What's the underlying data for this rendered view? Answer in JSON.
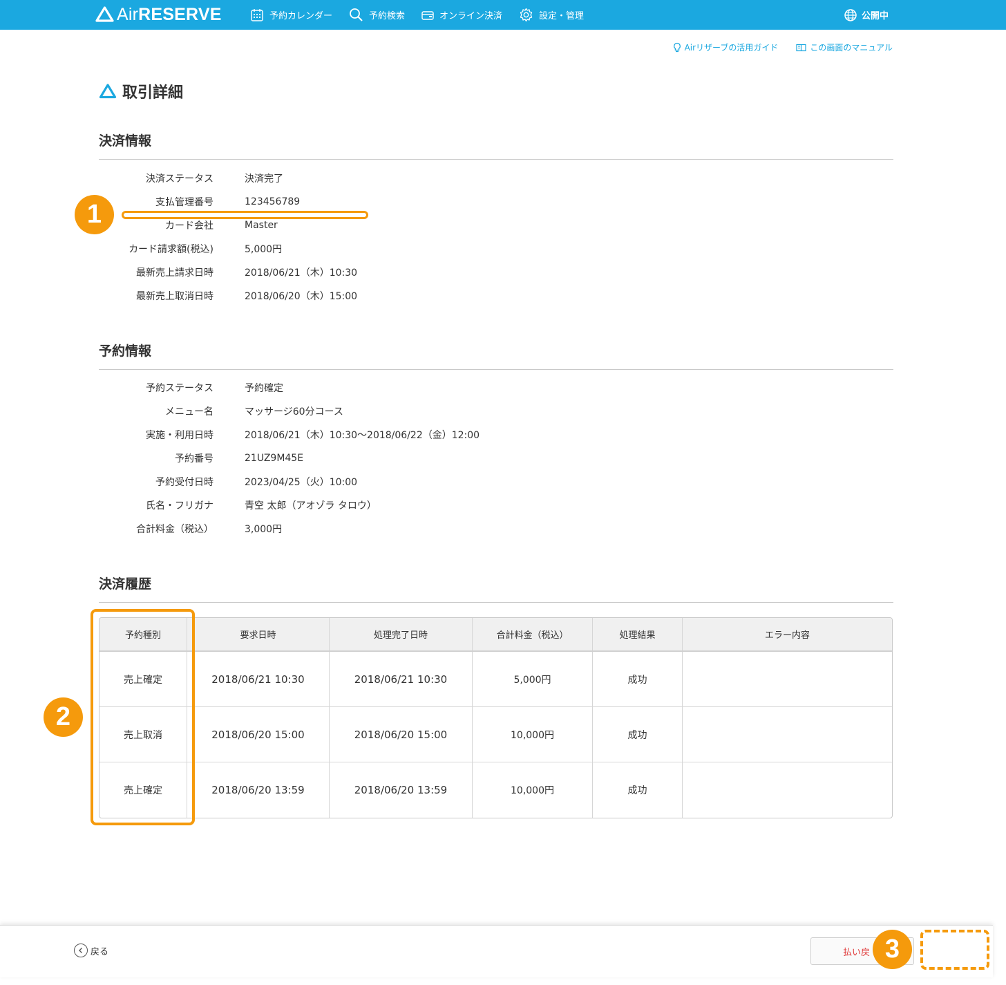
{
  "header": {
    "logo_air": "Air",
    "logo_reserve": "RESERVE",
    "nav": [
      {
        "label": "予約カレンダー",
        "icon": "calendar-icon"
      },
      {
        "label": "予約検索",
        "icon": "search-icon"
      },
      {
        "label": "オンライン決済",
        "icon": "wallet-icon"
      },
      {
        "label": "設定・管理",
        "icon": "gear-icon"
      }
    ],
    "public_label": "公開中"
  },
  "help": {
    "guide_label": "Airリザーブの活用ガイド",
    "manual_label": "この画面のマニュアル"
  },
  "page": {
    "title": "取引詳細"
  },
  "payment": {
    "title": "決済情報",
    "rows": [
      {
        "label": "決済ステータス",
        "value": "決済完了"
      },
      {
        "label": "支払管理番号",
        "value": "123456789"
      },
      {
        "label": "カード会社",
        "value": "Master"
      },
      {
        "label": "カード請求額(税込)",
        "value": "5,000円"
      },
      {
        "label": "最新売上請求日時",
        "value": "2018/06/21（木）10:30"
      },
      {
        "label": "最新売上取消日時",
        "value": "2018/06/20（木）15:00"
      }
    ]
  },
  "reservation": {
    "title": "予約情報",
    "rows": [
      {
        "label": "予約ステータス",
        "value": "予約確定"
      },
      {
        "label": "メニュー名",
        "value": "マッサージ60分コース"
      },
      {
        "label": "実施・利用日時",
        "value": "2018/06/21（木）10:30〜2018/06/22（金）12:00"
      },
      {
        "label": "予約番号",
        "value": "21UZ9M45E"
      },
      {
        "label": "予約受付日時",
        "value": "2023/04/25（火）10:00"
      },
      {
        "label": "氏名・フリガナ",
        "value": "青空 太郎（アオゾラ タロウ）"
      },
      {
        "label": "合計料金（税込）",
        "value": "3,000円"
      }
    ]
  },
  "history": {
    "title": "決済履歴",
    "headers": [
      "予約種別",
      "要求日時",
      "処理完了日時",
      "合計料金（税込）",
      "処理結果",
      "エラー内容"
    ],
    "rows": [
      [
        "売上確定",
        "2018/06/21 10:30",
        "2018/06/21 10:30",
        "5,000円",
        "成功",
        ""
      ],
      [
        "売上取消",
        "2018/06/20 15:00",
        "2018/06/20 15:00",
        "10,000円",
        "成功",
        ""
      ],
      [
        "売上確定",
        "2018/06/20 13:59",
        "2018/06/20 13:59",
        "10,000円",
        "成功",
        ""
      ]
    ]
  },
  "annotations": {
    "one": "1",
    "two": "2",
    "three": "3"
  },
  "footer": {
    "back_label": "戻る",
    "refund_label": "払い戻"
  },
  "colors": {
    "brand": "#1ba8e0",
    "accent": "#f59a0c",
    "danger": "#e03a3a"
  }
}
